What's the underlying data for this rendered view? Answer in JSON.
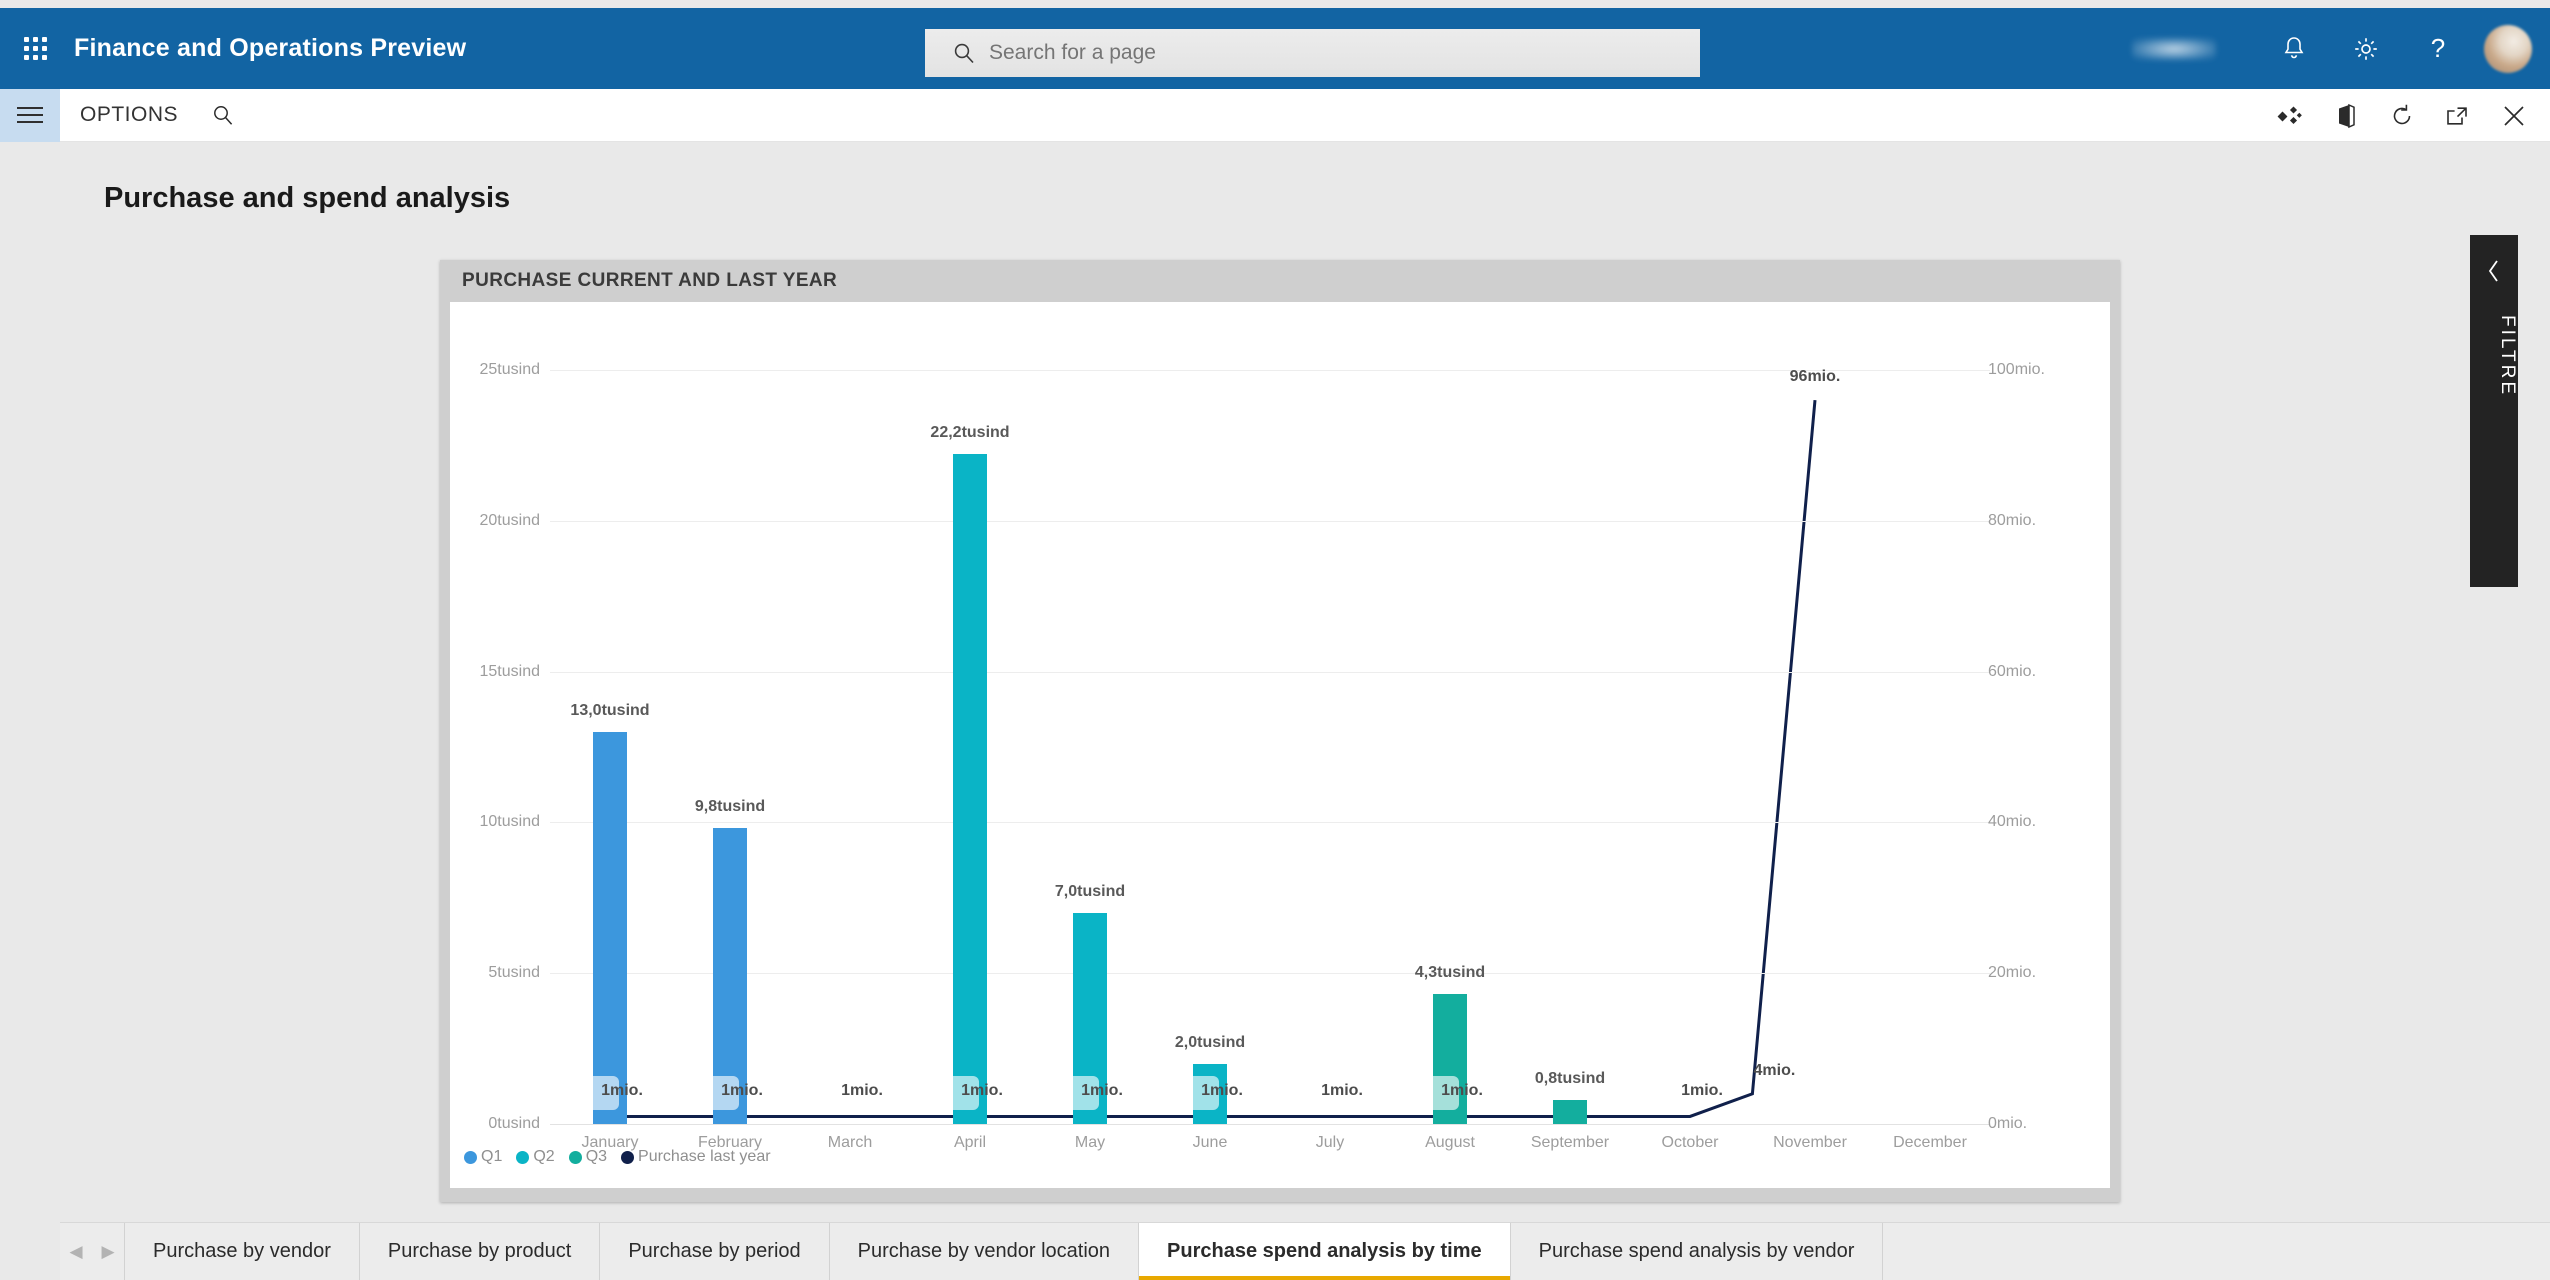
{
  "header": {
    "app_title": "Finance and Operations Preview",
    "waffle_icon": "app-launcher-waffle-icon",
    "search_placeholder": "Search for a page",
    "search_value": "",
    "search_icon": "search-icon",
    "company_chip": "",
    "notifications_icon": "bell-icon",
    "settings_icon": "gear-icon",
    "help_icon": "question-mark-icon",
    "avatar_icon": "user-avatar"
  },
  "commandbar": {
    "hamburger_icon": "hamburger-menu-icon",
    "options_label": "OPTIONS",
    "search_icon": "search-icon",
    "personalize_icon": "personalize-diamonds-icon",
    "office_icon": "open-in-office-icon",
    "refresh_icon": "refresh-icon",
    "popout_icon": "open-in-new-window-icon",
    "close_icon": "close-icon"
  },
  "page": {
    "title": "Purchase and spend analysis"
  },
  "card": {
    "title": "PURCHASE CURRENT AND LAST YEAR"
  },
  "filter": {
    "label": "FILTRE",
    "chevron_icon": "chevron-left-icon"
  },
  "tabs": {
    "prev_icon": "chevron-left-icon",
    "next_icon": "chevron-right-icon",
    "items": [
      {
        "label": "Purchase by vendor",
        "active": false
      },
      {
        "label": "Purchase by product",
        "active": false
      },
      {
        "label": "Purchase by period",
        "active": false
      },
      {
        "label": "Purchase by vendor location",
        "active": false
      },
      {
        "label": "Purchase spend analysis by time",
        "active": true
      },
      {
        "label": "Purchase spend analysis by vendor",
        "active": false
      }
    ]
  },
  "colors": {
    "brand_blue": "#1264a3",
    "q1": "#3c97dd",
    "q2": "#0ab4c6",
    "q3": "#13ae9e",
    "last_year": "#10204b",
    "active_tab_underline": "#e8a800",
    "filter_panel": "#232323"
  },
  "chart_data": {
    "type": "bar",
    "title": "PURCHASE CURRENT AND LAST YEAR",
    "xlabel": "",
    "ylabel": "",
    "grid": true,
    "legend_position": "bottom-left",
    "categories": [
      "January",
      "February",
      "March",
      "April",
      "May",
      "June",
      "July",
      "August",
      "September",
      "October",
      "November",
      "December"
    ],
    "left_axis": {
      "ticks": [
        "0tusind",
        "5tusind",
        "10tusind",
        "15tusind",
        "20tusind",
        "25tusind"
      ],
      "values": [
        0,
        5000,
        10000,
        15000,
        20000,
        25000
      ],
      "ylim": [
        0,
        25000
      ],
      "unit": "tusind"
    },
    "right_axis": {
      "ticks": [
        "0mio.",
        "20mio.",
        "40mio.",
        "60mio.",
        "80mio.",
        "100mio."
      ],
      "values": [
        0,
        20,
        40,
        60,
        80,
        100
      ],
      "ylim": [
        0,
        100
      ],
      "unit": "mio."
    },
    "series": [
      {
        "name": "Q1",
        "color": "#3c97dd",
        "axis": "left",
        "values": [
          13.0,
          9.8,
          0,
          null,
          null,
          null,
          null,
          null,
          null,
          null,
          null,
          null
        ],
        "labels": [
          "13,0tusind",
          "9,8tusind",
          "",
          "",
          "",
          "",
          "",
          "",
          "",
          "",
          "",
          ""
        ]
      },
      {
        "name": "Q2",
        "color": "#0ab4c6",
        "axis": "left",
        "values": [
          null,
          null,
          null,
          22.2,
          7.0,
          2.0,
          0,
          null,
          null,
          null,
          null,
          null
        ],
        "labels": [
          "",
          "",
          "",
          "22,2tusind",
          "7,0tusind",
          "2,0tusind",
          "",
          "",
          "",
          "",
          "",
          ""
        ]
      },
      {
        "name": "Q3",
        "color": "#13ae9e",
        "axis": "left",
        "values": [
          null,
          null,
          null,
          null,
          null,
          null,
          0,
          4.3,
          0.8,
          0,
          null,
          null
        ],
        "labels": [
          "",
          "",
          "",
          "",
          "",
          "",
          "",
          "4,3tusind",
          "0,8tusind",
          "",
          "",
          ""
        ]
      },
      {
        "name": "Purchase last year",
        "color": "#10204b",
        "axis": "right",
        "type": "line",
        "values": [
          1,
          1,
          1,
          1,
          1,
          1,
          1,
          1,
          1,
          1,
          96,
          null
        ],
        "labels": [
          "1mio.",
          "1mio.",
          "1mio.",
          "1mio.",
          "1mio.",
          "1mio.",
          "1mio.",
          "1mio.",
          "",
          "1mio.",
          "96mio.",
          ""
        ],
        "extra_point_label": "4mio."
      }
    ],
    "legend": [
      "Q1",
      "Q2",
      "Q3",
      "Purchase last year"
    ]
  }
}
